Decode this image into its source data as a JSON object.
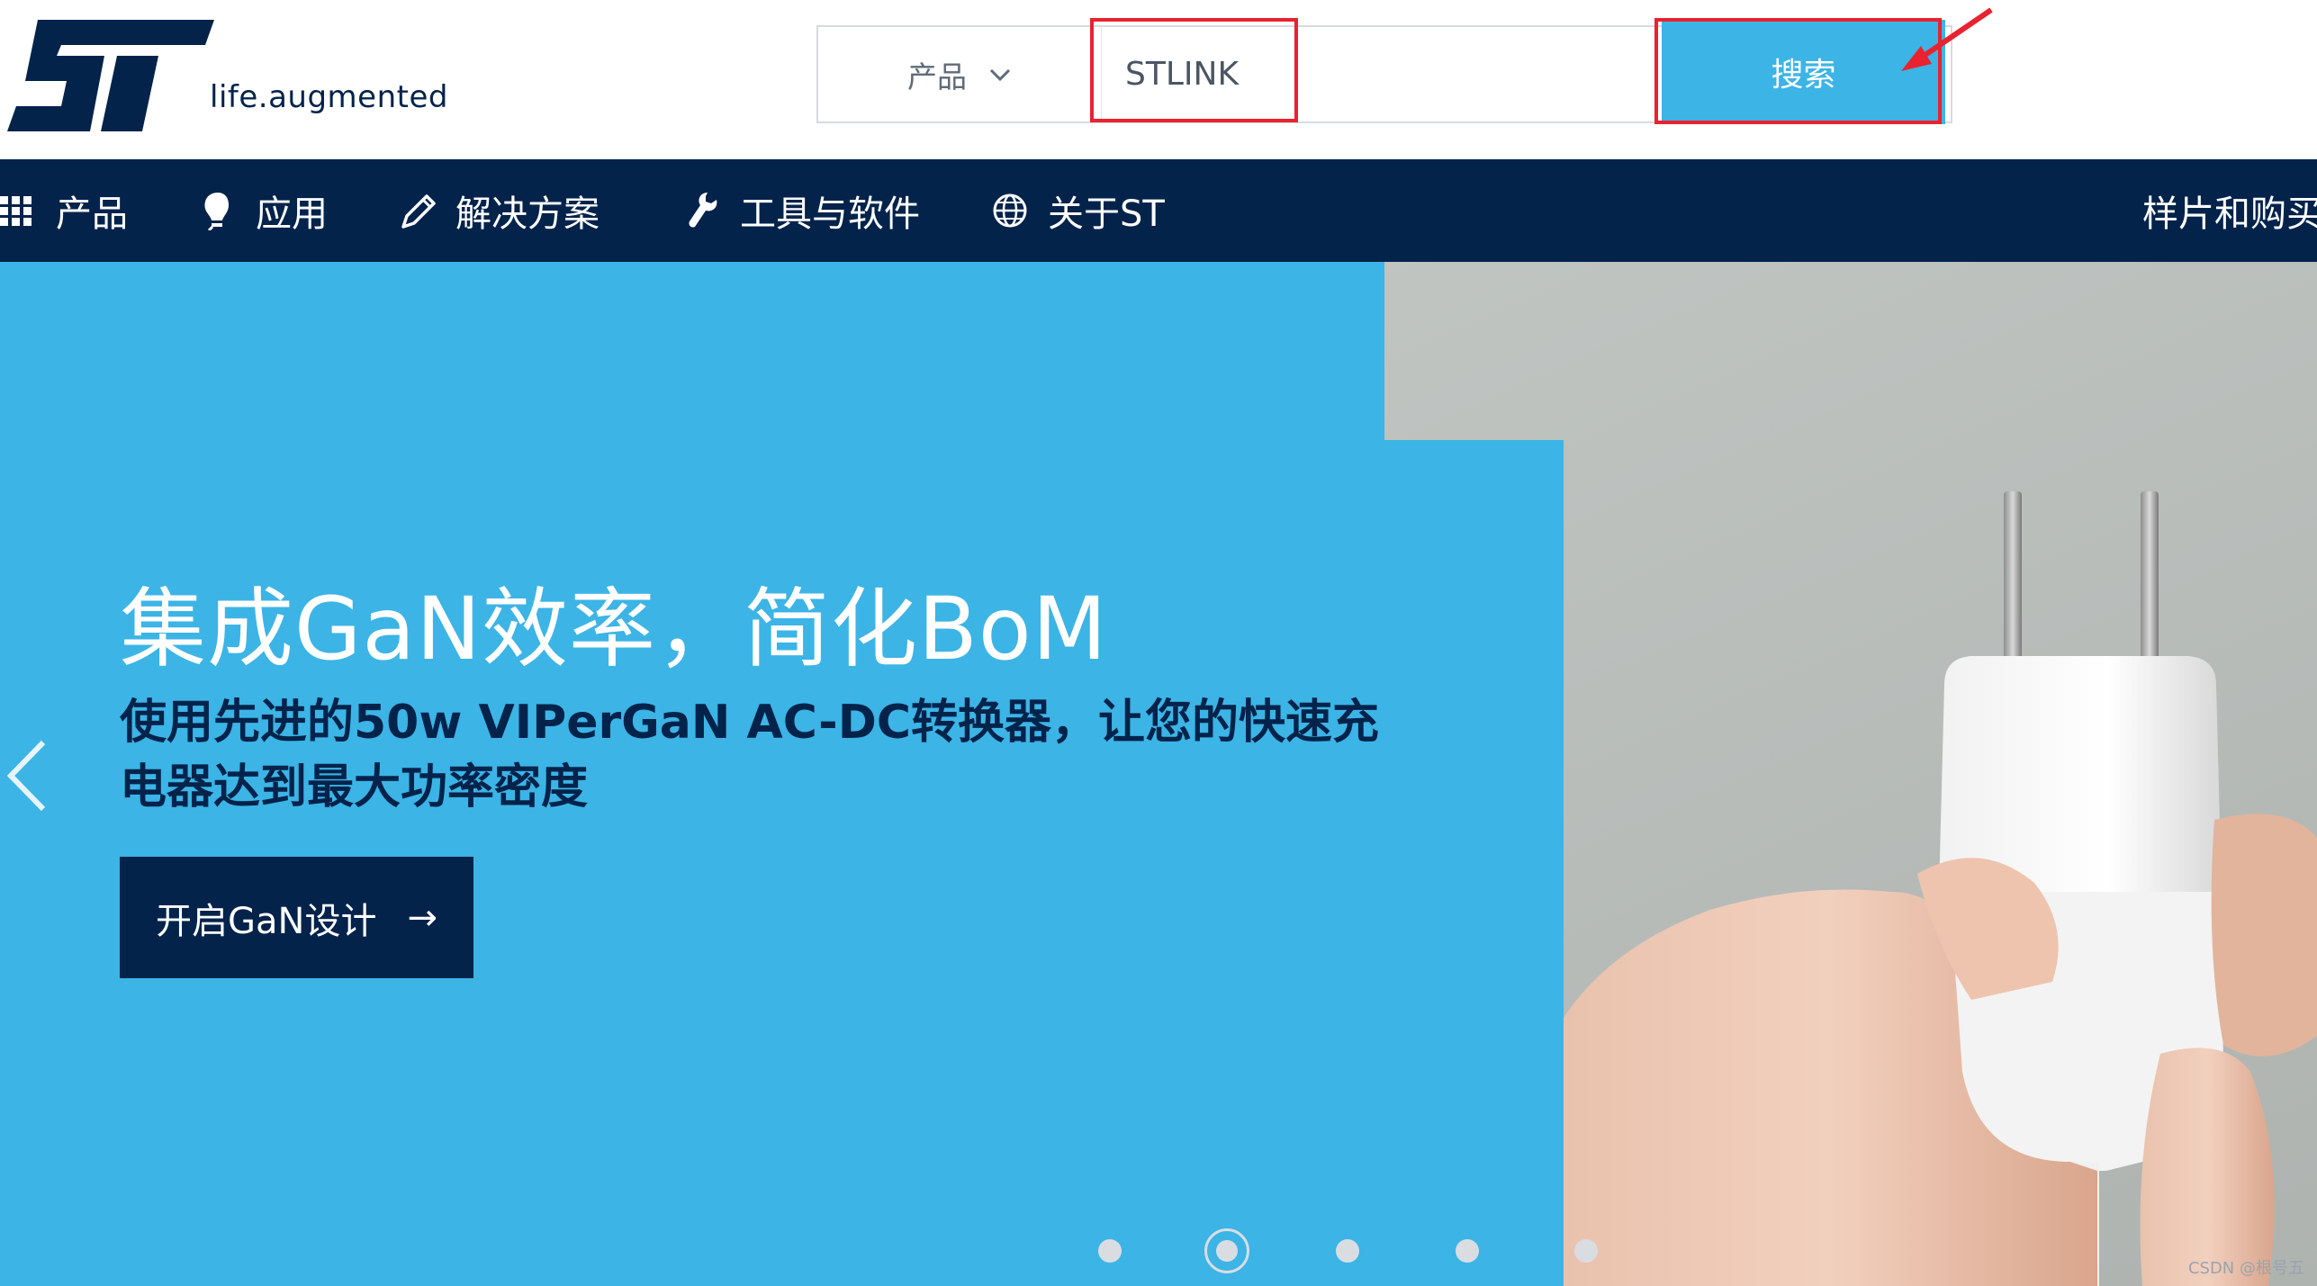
{
  "header": {
    "tagline": "life.augmented",
    "search": {
      "category": "产品",
      "query": "STLINK",
      "button_label": "搜索"
    }
  },
  "nav": {
    "items": [
      {
        "label": "产品",
        "icon": "grid-icon"
      },
      {
        "label": "应用",
        "icon": "bulb-icon"
      },
      {
        "label": "解决方案",
        "icon": "pencil-icon"
      },
      {
        "label": "工具与软件",
        "icon": "wrench-icon"
      },
      {
        "label": "关于ST",
        "icon": "globe-icon"
      }
    ],
    "right_label": "样片和购买"
  },
  "hero": {
    "title": "集成GaN效率，简化BoM",
    "subtitle": "使用先进的50w VIPerGaN AC-DC转换器，让您的快速充电器达到最大功率密度",
    "cta_label": "开启GaN设计",
    "cta_arrow": "→",
    "slide_count": 5,
    "active_slide": 2
  },
  "watermark": "CSDN @根号五",
  "colors": {
    "navy": "#03234b",
    "accent_blue": "#3cb4e6",
    "annotation_red": "#e8232f"
  }
}
